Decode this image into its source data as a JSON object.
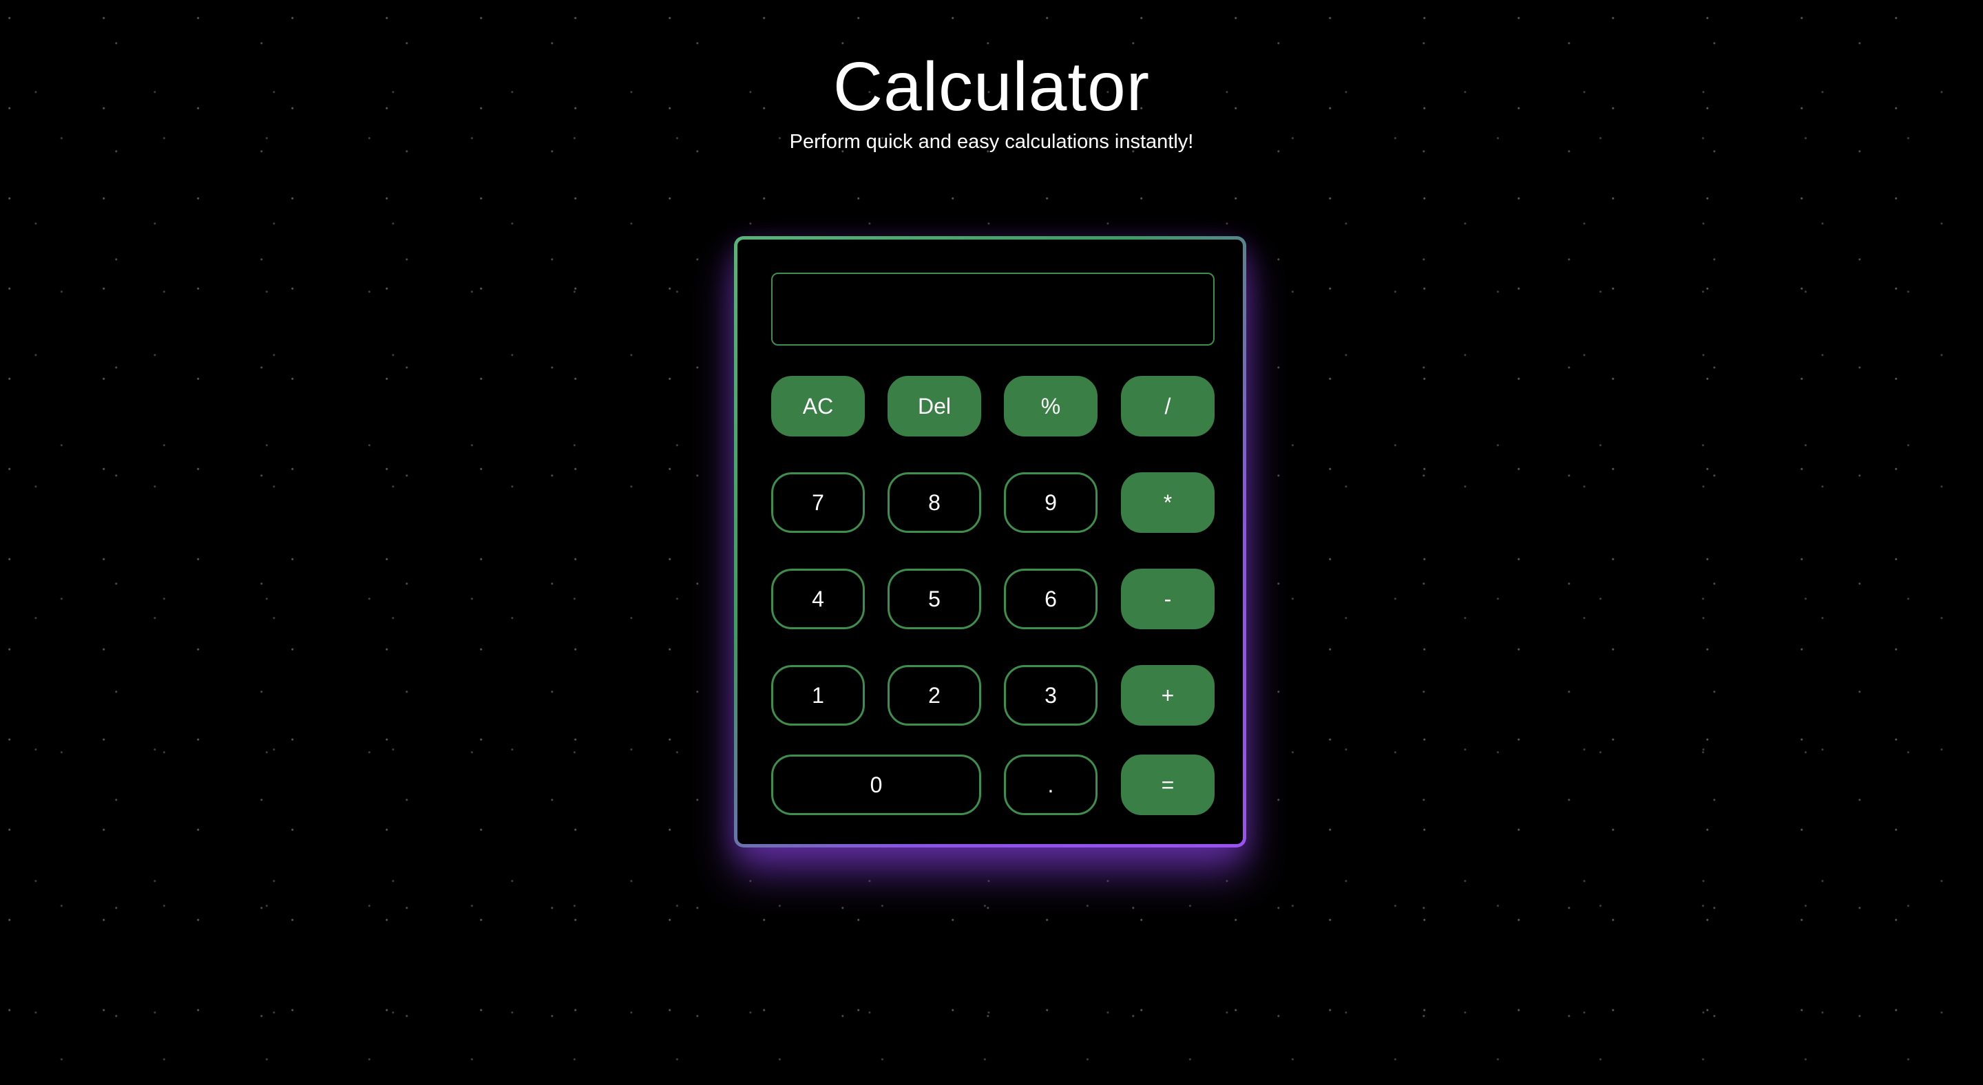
{
  "header": {
    "title": "Calculator",
    "subtitle": "Perform quick and easy calculations instantly!"
  },
  "display": {
    "value": ""
  },
  "buttons": {
    "clear": "AC",
    "delete": "Del",
    "percent": "%",
    "divide": "/",
    "seven": "7",
    "eight": "8",
    "nine": "9",
    "multiply": "*",
    "four": "4",
    "five": "5",
    "six": "6",
    "subtract": "-",
    "one": "1",
    "two": "2",
    "three": "3",
    "add": "+",
    "zero": "0",
    "decimal": ".",
    "equals": "="
  },
  "colors": {
    "background": "#000000",
    "operator_fill": "#3a7f45",
    "digit_border": "#3e8e4c",
    "border_gradient_start": "#5bb37a",
    "border_gradient_end": "#9a52f0",
    "glow": "#8a42e6"
  }
}
